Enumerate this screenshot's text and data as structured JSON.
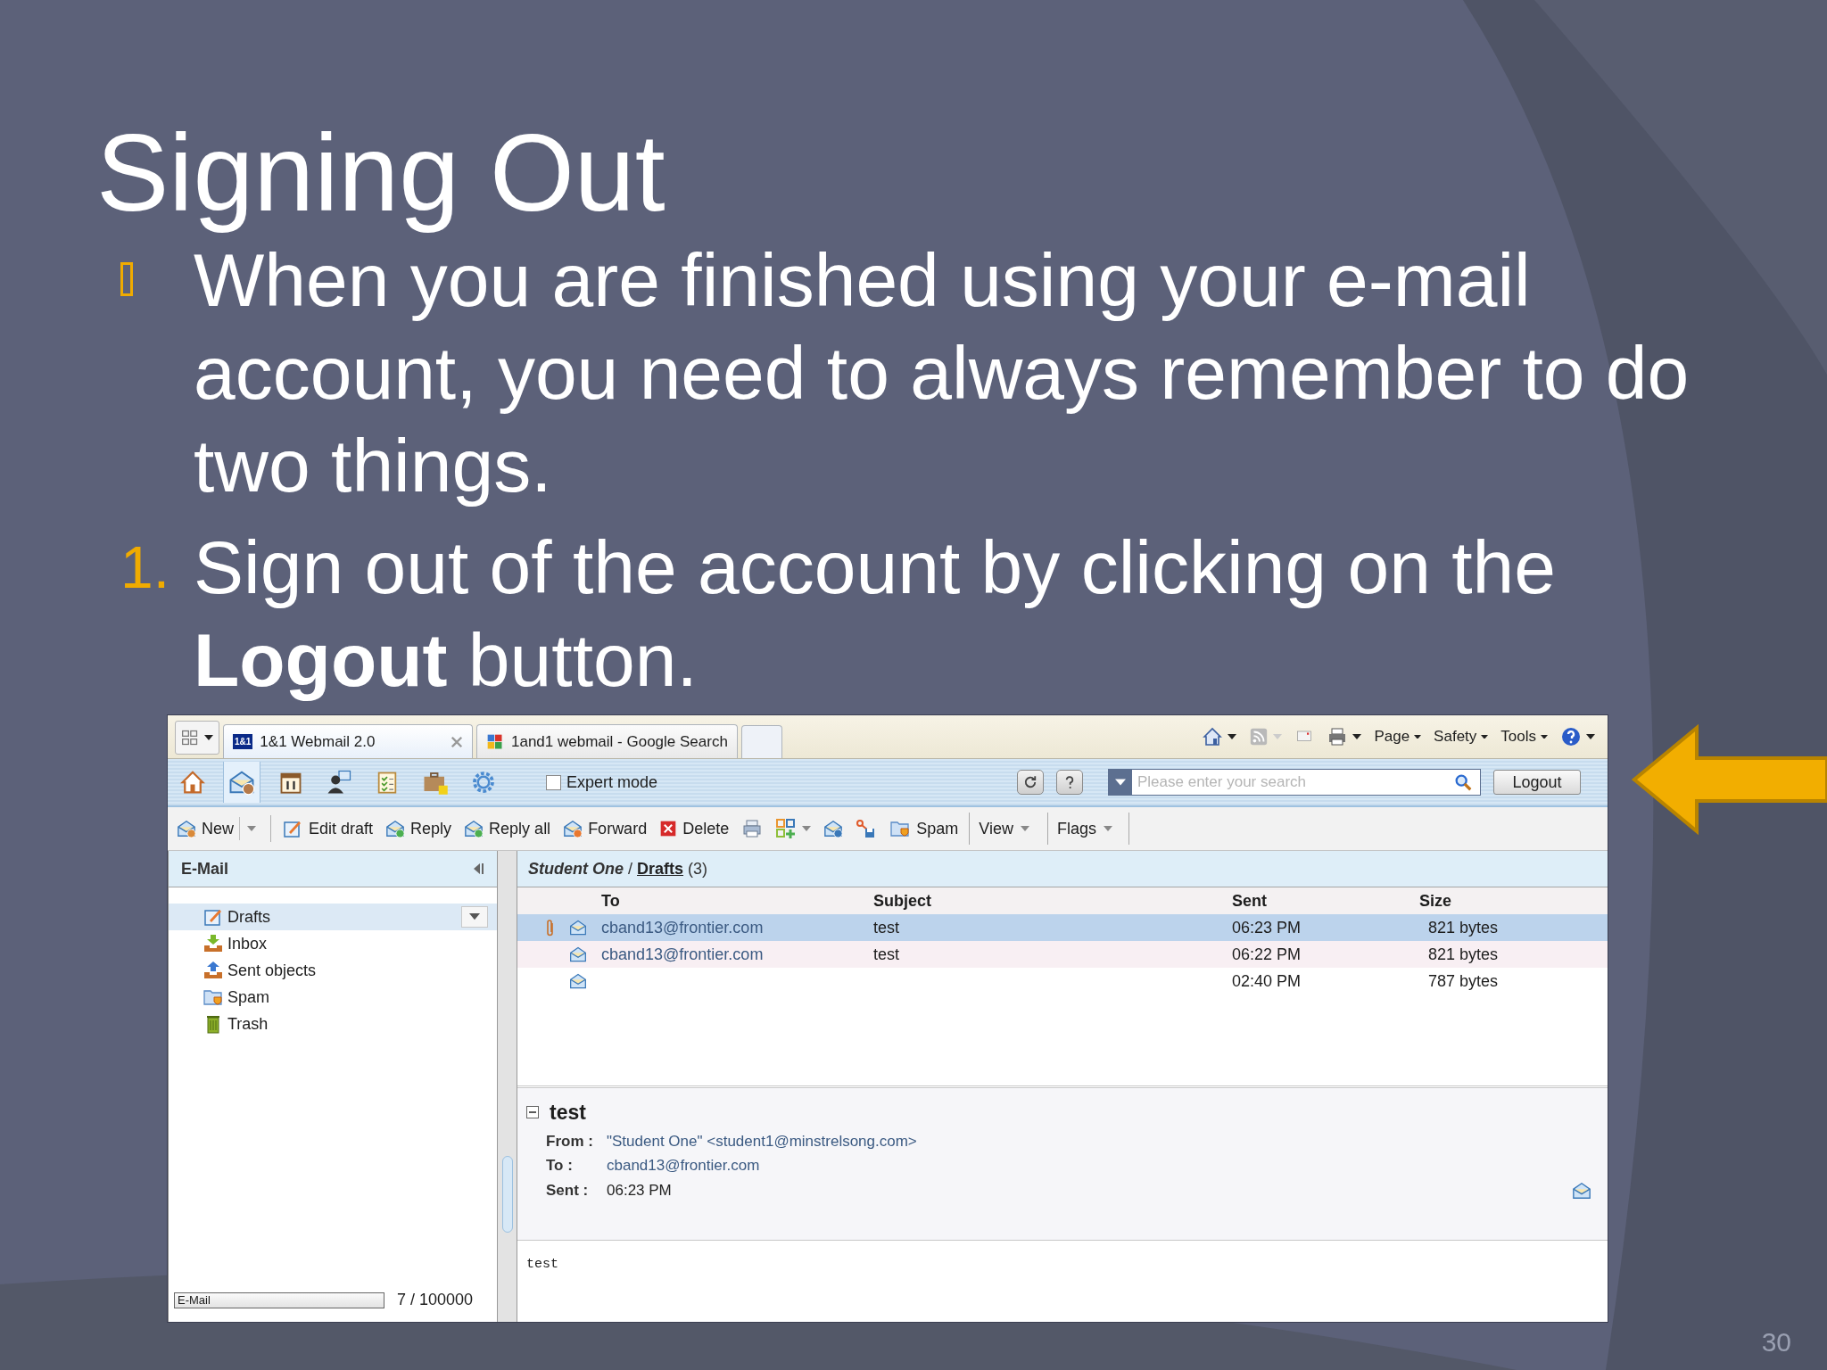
{
  "slide": {
    "title": "Signing Out",
    "bullets": [
      {
        "kind": "symbol",
        "text": "When you are finished using your e-mail account, you need to always remember to do two things."
      },
      {
        "kind": "number",
        "marker": "1.",
        "text": "Sign out of the account by clicking on the **Logout** button."
      }
    ],
    "page_number": "30"
  },
  "browser": {
    "tabs": [
      {
        "label": "1&1 Webmail 2.0",
        "logo": "1&1",
        "selected": true
      },
      {
        "label": "1and1 webmail - Google Search",
        "selected": false
      }
    ],
    "commands": [
      "Page",
      "Safety",
      "Tools"
    ]
  },
  "app": {
    "expert_mode": {
      "label": "Expert mode",
      "checked": false
    },
    "search": {
      "placeholder": "Please enter your search"
    },
    "logout": "Logout",
    "actions": [
      {
        "kind": "button",
        "label": "New",
        "dropdown": true
      },
      {
        "kind": "button",
        "label": "Edit draft",
        "dropdown": false
      },
      {
        "kind": "button",
        "label": "Reply",
        "dropdown": false
      },
      {
        "kind": "button",
        "label": "Reply all",
        "dropdown": false
      },
      {
        "kind": "button",
        "label": "Forward",
        "dropdown": false
      },
      {
        "kind": "button",
        "label": "Delete",
        "dropdown": false
      },
      {
        "kind": "icon",
        "dropdown": false
      },
      {
        "kind": "icon",
        "dropdown": true
      },
      {
        "kind": "icon",
        "dropdown": false
      },
      {
        "kind": "icon",
        "dropdown": false
      },
      {
        "kind": "button",
        "label": "Spam",
        "dropdown": false
      },
      {
        "kind": "menu",
        "label": "View",
        "dropdown": true
      },
      {
        "kind": "menu",
        "label": "Flags",
        "dropdown": true
      }
    ],
    "sidebar": {
      "title": "E-Mail",
      "folders": [
        {
          "label": "Drafts",
          "selected": true
        },
        {
          "label": "Inbox",
          "selected": false
        },
        {
          "label": "Sent objects",
          "selected": false
        },
        {
          "label": "Spam",
          "selected": false
        },
        {
          "label": "Trash",
          "selected": false
        }
      ],
      "quota": {
        "label": "E-Mail",
        "level": 0,
        "reading": "7 / 100000"
      }
    },
    "breadcrumb": {
      "account": "Student One",
      "separator": "/",
      "folder": "Drafts",
      "count": "(3)"
    },
    "messages": {
      "columns": [
        "To",
        "Subject",
        "Sent",
        "Size"
      ],
      "rows": [
        {
          "attachment": true,
          "to": "cband13@frontier.com",
          "subject": "test",
          "sent": "06:23 PM",
          "size": "821 bytes",
          "selected": true
        },
        {
          "attachment": false,
          "to": "cband13@frontier.com",
          "subject": "test",
          "sent": "06:22 PM",
          "size": "821 bytes",
          "selected": false
        },
        {
          "attachment": false,
          "sent": "02:40 PM",
          "size": "787 bytes",
          "selected": false
        }
      ]
    },
    "preview": {
      "title": "test",
      "expanded": true,
      "fields": [
        {
          "label": "From :",
          "value": "\"Student One\" <student1@minstrelsong.com>"
        },
        {
          "label": "To :",
          "value": "cband13@frontier.com"
        },
        {
          "label": "Sent :",
          "value": "06:23 PM"
        }
      ],
      "body": "test"
    }
  }
}
